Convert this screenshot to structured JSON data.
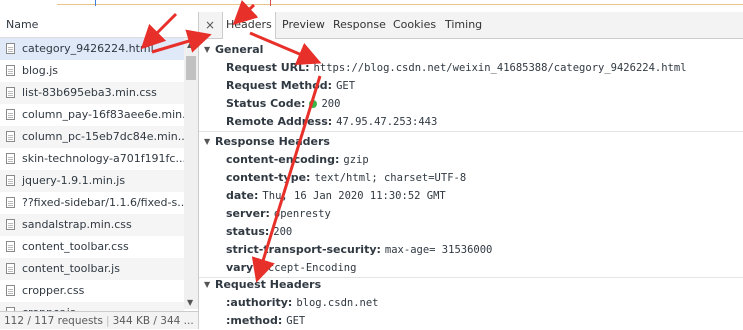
{
  "left_panel": {
    "header": "Name",
    "files": [
      "category_9426224.html",
      "blog.js",
      "list-83b695eba3.min.css",
      "column_pay-16f83aee6e.min...",
      "column_pc-15eb7dc84e.min...",
      "skin-technology-a701f191fc...",
      "jquery-1.9.1.min.js",
      "??fixed-sidebar/1.1.6/fixed-s...",
      "sandalstrap.min.css",
      "content_toolbar.css",
      "content_toolbar.js",
      "cropper.css",
      "cropper.js"
    ],
    "status": {
      "requests": "112 / 117 requests",
      "size": "344 KB / 344 ..."
    }
  },
  "tabs": {
    "close": "×",
    "items": [
      "Headers",
      "Preview",
      "Response",
      "Cookies",
      "Timing"
    ],
    "active": "Headers"
  },
  "general": {
    "title": "General",
    "request_url_label": "Request URL:",
    "request_url": "https://blog.csdn.net/weixin_41685388/category_9426224.html",
    "request_method_label": "Request Method:",
    "request_method": "GET",
    "status_code_label": "Status Code:",
    "status_code": "200",
    "remote_address_label": "Remote Address:",
    "remote_address": "47.95.47.253:443"
  },
  "response_headers": {
    "title": "Response Headers",
    "items": [
      {
        "key": "content-encoding:",
        "value": "gzip"
      },
      {
        "key": "content-type:",
        "value": "text/html; charset=UTF-8"
      },
      {
        "key": "date:",
        "value": "Thu, 16 Jan 2020 11:30:52 GMT"
      },
      {
        "key": "server:",
        "value": "openresty"
      },
      {
        "key": "status:",
        "value": "200"
      },
      {
        "key": "strict-transport-security:",
        "value": "max-age= 31536000"
      },
      {
        "key": "vary:",
        "value": "Accept-Encoding"
      }
    ]
  },
  "request_headers": {
    "title": "Request Headers",
    "items": [
      {
        "key": ":authority:",
        "value": "blog.csdn.net"
      },
      {
        "key": ":method:",
        "value": "GET"
      }
    ]
  },
  "colors": {
    "annotation_arrow": "#e8302a",
    "status_dot": "#3bb44a",
    "selected_row": "#dfe9f8"
  }
}
